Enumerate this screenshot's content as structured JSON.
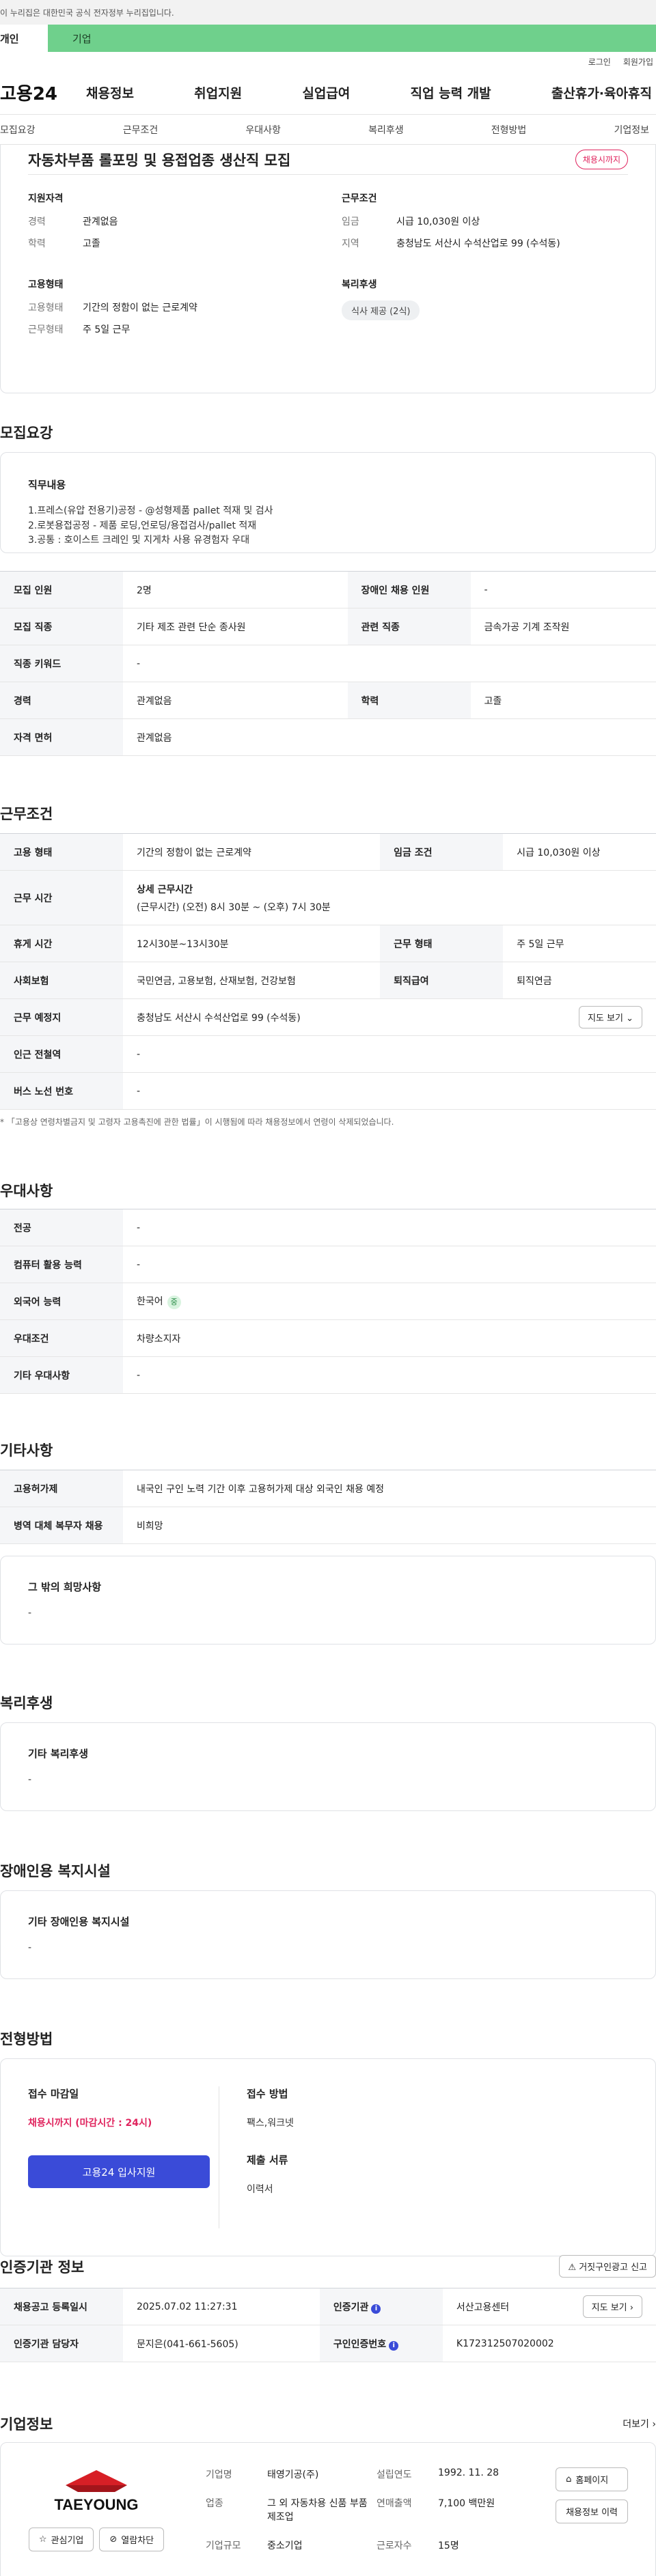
{
  "gov_banner": "이 누리집은 대한민국 공식 전자정부 누리집입니다.",
  "top_tabs": {
    "personal": "개인",
    "company": "기업"
  },
  "util": {
    "login": "로그인",
    "signup": "회원가입"
  },
  "logo": "고용24",
  "gnb": [
    "채용정보",
    "취업지원",
    "실업급여",
    "직업 능력 개발",
    "출산휴가·육아휴직"
  ],
  "subnav": [
    "모집요강",
    "근무조건",
    "우대사항",
    "복리후생",
    "전형방법",
    "기업정보"
  ],
  "summary": {
    "title": "자동차부품 롤포밍 및 용접업종 생산직 모집",
    "badge": "채용시까지",
    "qual_title": "지원자격",
    "career_k": "경력",
    "career_v": "관계없음",
    "edu_k": "학력",
    "edu_v": "고졸",
    "cond_title": "근무조건",
    "wage_k": "임금",
    "wage_v": "시급 10,030원 이상",
    "region_k": "지역",
    "region_v": "충청남도 서산시 수석산업로 99 (수석동)",
    "emp_title": "고용형태",
    "emptype_k": "고용형태",
    "emptype_v": "기간의 정함이 없는 근로계약",
    "workform_k": "근무형태",
    "workform_v": "주 5일 근무",
    "welfare_title": "복리후생",
    "welfare_pill": "식사 제공 (2식)"
  },
  "recruit": {
    "title": "모집요강",
    "duty_title": "직무내용",
    "duty_text": "1.프레스(유압 전용기)공정 - @성형제품 pallet 적재 및 검사\n2.로봇용접공정 - 제품 로딩,언로딩/용접검사/pallet 적재\n3.공통 : 호이스트 크레인 및 지게차 사용 유경험자 우대",
    "rows": [
      [
        "모집 인원",
        "2명",
        "장애인 채용 인원",
        "-"
      ],
      [
        "모집 직종",
        "기타 제조 관련 단순 종사원",
        "관련 직종",
        "금속가공 기계 조작원"
      ],
      [
        "직종 키워드",
        "-"
      ],
      [
        "경력",
        "관계없음",
        "학력",
        "고졸"
      ],
      [
        "자격 면허",
        "관계없음"
      ]
    ]
  },
  "work": {
    "title": "근무조건",
    "r1": [
      "고용 형태",
      "기간의 정함이 없는 근로계약",
      "임금 조건",
      "시급 10,030원 이상"
    ],
    "r2_k": "근무 시간",
    "r2_title": "상세 근무시간",
    "r2_v": "(근무시간) (오전) 8시 30분 ~ (오후) 7시 30분",
    "r3": [
      "휴게 시간",
      "12시30분~13시30분",
      "근무 형태",
      "주 5일 근무"
    ],
    "r4": [
      "사회보험",
      "국민연금, 고용보험, 산재보험, 건강보험",
      "퇴직급여",
      "퇴직연금"
    ],
    "r5_k": "근무 예정지",
    "r5_v": "충청남도 서산시 수석산업로 99 (수석동)",
    "map_btn": "지도 보기",
    "r6": [
      "인근 전철역",
      "-"
    ],
    "r7": [
      "버스 노선 번호",
      "-"
    ],
    "note": "* 「고용상 연령차별금지 및 고령자 고용촉진에 관한 법률」이 시행됨에 따라 채용정보에서 연령이 삭제되었습니다."
  },
  "pref": {
    "title": "우대사항",
    "rows": [
      [
        "전공",
        "-"
      ],
      [
        "컴퓨터 활용 능력",
        "-"
      ],
      [
        "외국어 능력",
        "한국어"
      ],
      [
        "우대조건",
        "차량소지자"
      ],
      [
        "기타 우대사항",
        "-"
      ]
    ],
    "lang_badge": "중"
  },
  "etc": {
    "title": "기타사항",
    "rows": [
      [
        "고용허가제",
        "내국인 구인 노력 기간 이후 고용허가제 대상 외국인 채용 예정"
      ],
      [
        "병역 대체 복무자 채용",
        "비희망"
      ]
    ],
    "other_title": "그 밖의 희망사항",
    "other_text": "-"
  },
  "welfare": {
    "title": "복리후생",
    "box_title": "기타 복리후생",
    "box_text": "-"
  },
  "disabled": {
    "title": "장애인용 복지시설",
    "box_title": "기타 장애인용 복지시설",
    "box_text": "-"
  },
  "process": {
    "title": "전형방법",
    "deadline_title": "접수 마감일",
    "deadline_text": "채용시까지 (마감시간 : 24시)",
    "apply_btn": "고용24 입사지원",
    "method_title": "접수 방법",
    "method_text": "팩스,워크넷",
    "docs_title": "제출 서류",
    "docs_text": "이력서"
  },
  "agency": {
    "title": "인증기관 정보",
    "report_btn": "거짓구인광고 신고",
    "r1": [
      "채용공고 등록일시",
      "2025.07.02 11:27:31",
      "인증기관",
      "서산고용센터"
    ],
    "map_btn": "지도 보기",
    "r2": [
      "인증기관 담당자",
      "문지은(041-661-5605)",
      "구인인증번호",
      "K172312507020002"
    ]
  },
  "company": {
    "title": "기업정보",
    "more": "더보기",
    "logo_text": "TAEYOUNG",
    "fav_btn": "관심기업",
    "block_btn": "열람차단",
    "name_k": "기업명",
    "name_v": "태영기공(주)",
    "ind_k": "업종",
    "ind_v": "그 외 자동차용 신품 부품 제조업",
    "size_k": "기업규모",
    "size_v": "중소기업",
    "est_k": "설립연도",
    "est_v": "1992. 11. 28",
    "sales_k": "연매출액",
    "sales_v": "7,100 백만원",
    "staff_k": "근로자수",
    "staff_v": "15명",
    "home_btn": "홈페이지",
    "jobs_btn": "채용정보 이력"
  }
}
